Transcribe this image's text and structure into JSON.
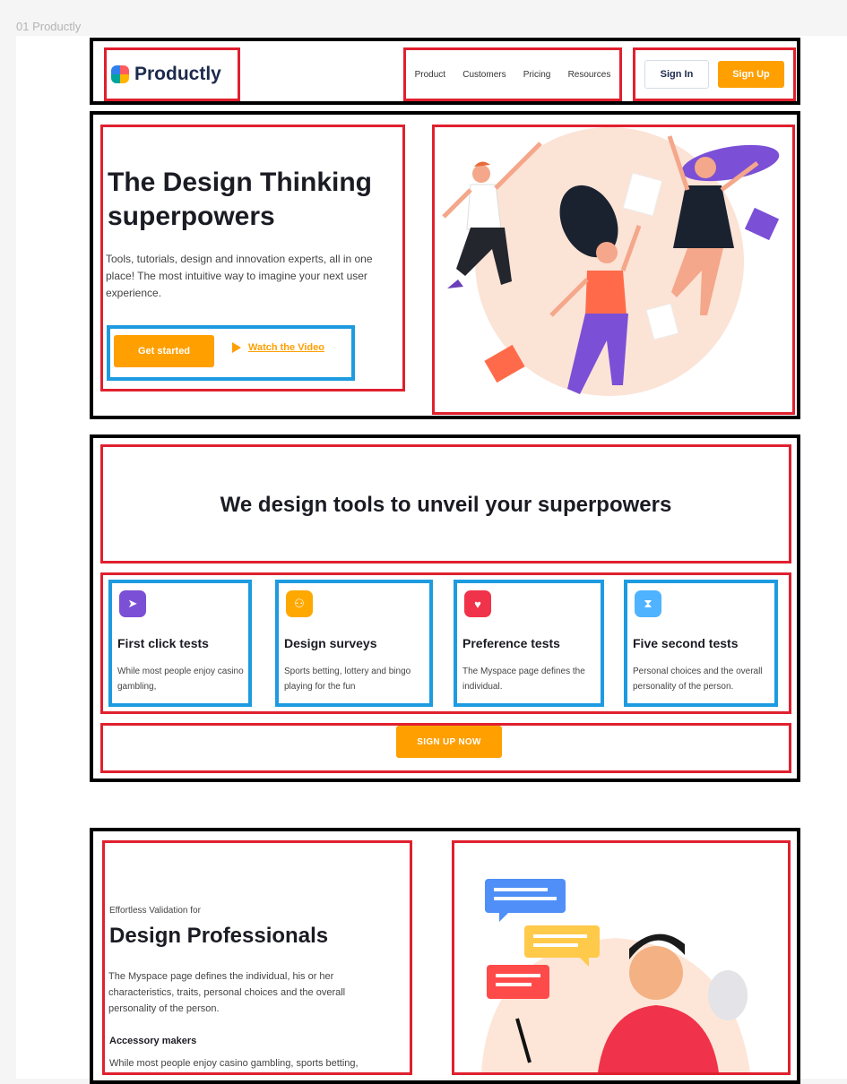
{
  "frame_label": "01 Productly",
  "nav": {
    "logo_text": "Productly",
    "links": [
      "Product",
      "Customers",
      "Pricing",
      "Resources"
    ],
    "sign_in": "Sign In",
    "sign_up": "Sign Up"
  },
  "hero": {
    "title": "The Design Thinking superpowers",
    "description": "Tools, tutorials, design and innovation experts, all in one place! The most intuitive way to imagine your next user experience.",
    "cta_primary": "Get started",
    "cta_secondary": "Watch the Video"
  },
  "features": {
    "title": "We design tools to unveil your superpowers",
    "cards": [
      {
        "icon": "cursor-icon",
        "color": "#7b4fd6",
        "glyph": "➤",
        "title": "First click tests",
        "text": "While most people enjoy casino gambling,"
      },
      {
        "icon": "survey-icon",
        "color": "#ffa800",
        "glyph": "⚇",
        "title": "Design surveys",
        "text": "Sports betting, lottery and bingo playing for the fun"
      },
      {
        "icon": "heart-icon",
        "color": "#f0334a",
        "glyph": "♥",
        "title": "Preference tests",
        "text": "The Myspace page defines the individual."
      },
      {
        "icon": "hourglass-icon",
        "color": "#4fb3ff",
        "glyph": "⧗",
        "title": "Five second tests",
        "text": "Personal choices and the overall personality of the person."
      }
    ],
    "cta": "SIGN UP NOW"
  },
  "validation": {
    "eyebrow": "Effortless Validation for",
    "title": "Design Professionals",
    "description": "The Myspace page defines the individual, his or her characteristics, traits, personal choices and the overall personality of the person.",
    "sub_title": "Accessory makers",
    "sub_text": "While most people enjoy casino gambling, sports betting,"
  },
  "colors": {
    "accent": "#ff9f00",
    "annotation_red": "#e0202e",
    "annotation_blue": "#1e9be0",
    "annotation_black": "#000000"
  }
}
